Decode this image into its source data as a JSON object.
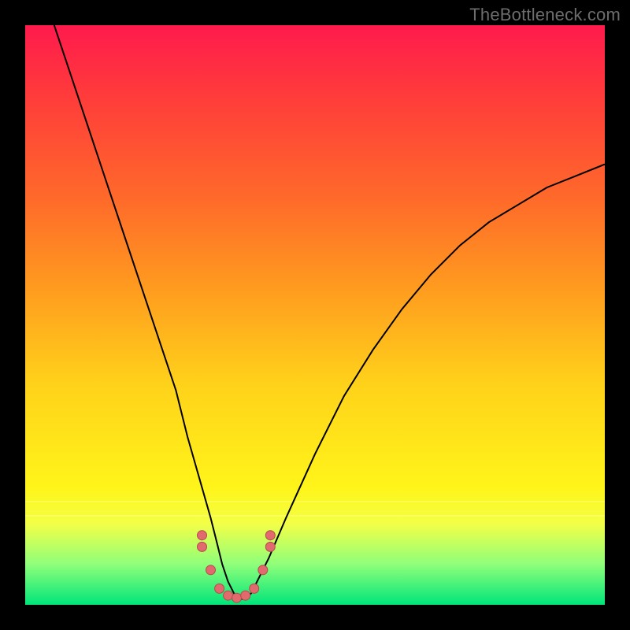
{
  "watermark": "TheBottleneck.com",
  "colors": {
    "gradient_top": "#ff1a4d",
    "gradient_bottom": "#00e57a",
    "dot_fill": "#e16a6f",
    "dot_stroke": "#b54a4a",
    "curve": "#000000",
    "frame": "#000000"
  },
  "chart_data": {
    "type": "line",
    "title": "",
    "xlabel": "",
    "ylabel": "",
    "xlim": [
      0,
      100
    ],
    "ylim": [
      0,
      100
    ],
    "grid": false,
    "legend": false,
    "series": [
      {
        "name": "bottleneck_curve",
        "x": [
          5,
          8,
          11,
          14,
          17,
          20,
          23,
          26,
          28,
          30,
          32,
          33,
          34,
          35,
          36,
          37,
          38,
          39,
          40,
          42,
          45,
          50,
          55,
          60,
          65,
          70,
          75,
          80,
          85,
          90,
          95,
          100
        ],
        "y": [
          100,
          91,
          82,
          73,
          64,
          55,
          46,
          37,
          29,
          22,
          15,
          11,
          7,
          4,
          2,
          1,
          1,
          2,
          4,
          8,
          15,
          26,
          36,
          44,
          51,
          57,
          62,
          66,
          69,
          72,
          74,
          76
        ]
      }
    ],
    "markers": [
      {
        "x": 30.5,
        "y": 12,
        "r": 6
      },
      {
        "x": 30.5,
        "y": 10,
        "r": 6
      },
      {
        "x": 32.0,
        "y": 6.0,
        "r": 6
      },
      {
        "x": 33.5,
        "y": 2.8,
        "r": 6
      },
      {
        "x": 35.0,
        "y": 1.6,
        "r": 6
      },
      {
        "x": 36.5,
        "y": 1.2,
        "r": 6
      },
      {
        "x": 38.0,
        "y": 1.6,
        "r": 6
      },
      {
        "x": 39.5,
        "y": 2.8,
        "r": 6
      },
      {
        "x": 41.0,
        "y": 6.0,
        "r": 6
      },
      {
        "x": 42.3,
        "y": 10,
        "r": 6
      },
      {
        "x": 42.3,
        "y": 12,
        "r": 6
      }
    ]
  }
}
